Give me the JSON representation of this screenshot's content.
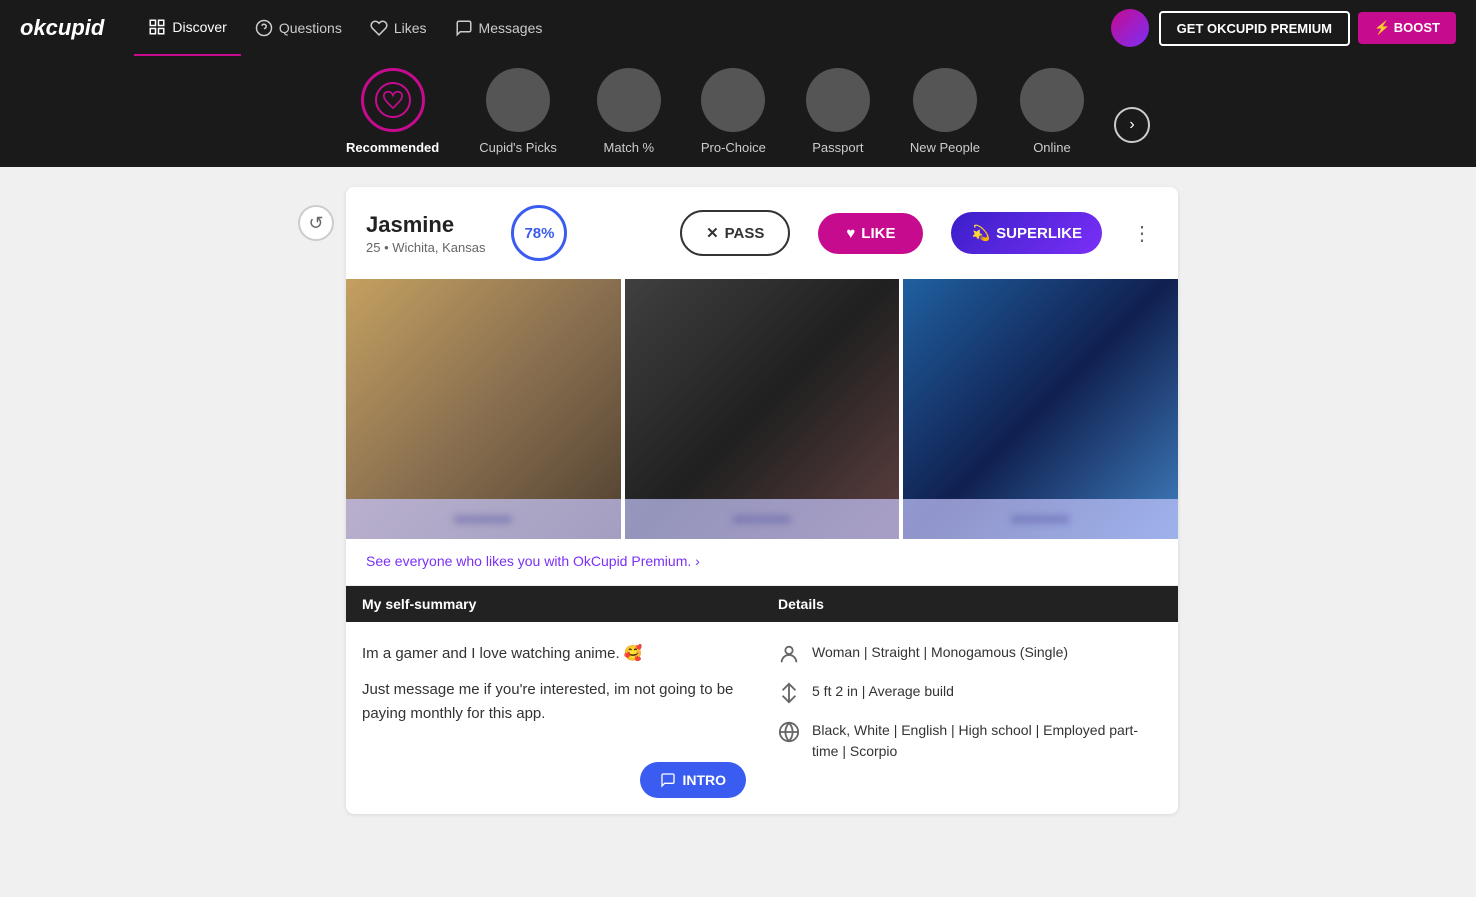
{
  "brand": {
    "name": "okcupid"
  },
  "nav": {
    "items": [
      {
        "id": "discover",
        "label": "Discover",
        "active": true
      },
      {
        "id": "questions",
        "label": "Questions",
        "active": false
      },
      {
        "id": "likes",
        "label": "Likes",
        "active": false
      },
      {
        "id": "messages",
        "label": "Messages",
        "active": false
      }
    ],
    "premium_btn": "GET OKCUPID PREMIUM",
    "boost_btn": "⚡ BOOST"
  },
  "discover_bar": {
    "items": [
      {
        "id": "recommended",
        "label": "Recommended",
        "active": true,
        "icon": "heart"
      },
      {
        "id": "cupids_picks",
        "label": "Cupid's Picks",
        "active": false
      },
      {
        "id": "match",
        "label": "Match %",
        "active": false
      },
      {
        "id": "pro_choice",
        "label": "Pro-Choice",
        "active": false
      },
      {
        "id": "passport",
        "label": "Passport",
        "active": false
      },
      {
        "id": "new_people",
        "label": "New People",
        "active": false
      },
      {
        "id": "online",
        "label": "Online",
        "active": false
      }
    ],
    "next_label": "›"
  },
  "profile": {
    "name": "Jasmine",
    "age": "25",
    "location": "Wichita, Kansas",
    "match_percent": "78%",
    "actions": {
      "pass": "PASS",
      "like": "LIKE",
      "superlike": "SUPERLIKE"
    },
    "premium_prompt": "See everyone who likes you with OkCupid Premium. ›",
    "self_summary": {
      "header": "My self-summary",
      "text1": "Im a gamer and I love watching anime. 🥰",
      "text2": "Just message me if you're interested, im not going to be paying monthly for this app."
    },
    "details": {
      "header": "Details",
      "orientation": "Woman | Straight | Monogamous (Single)",
      "height_build": "5 ft 2 in | Average build",
      "ethnicity_lang": "Black, White | English | High school | Employed part-time | Scorpio"
    },
    "intro_btn": "INTRO"
  }
}
